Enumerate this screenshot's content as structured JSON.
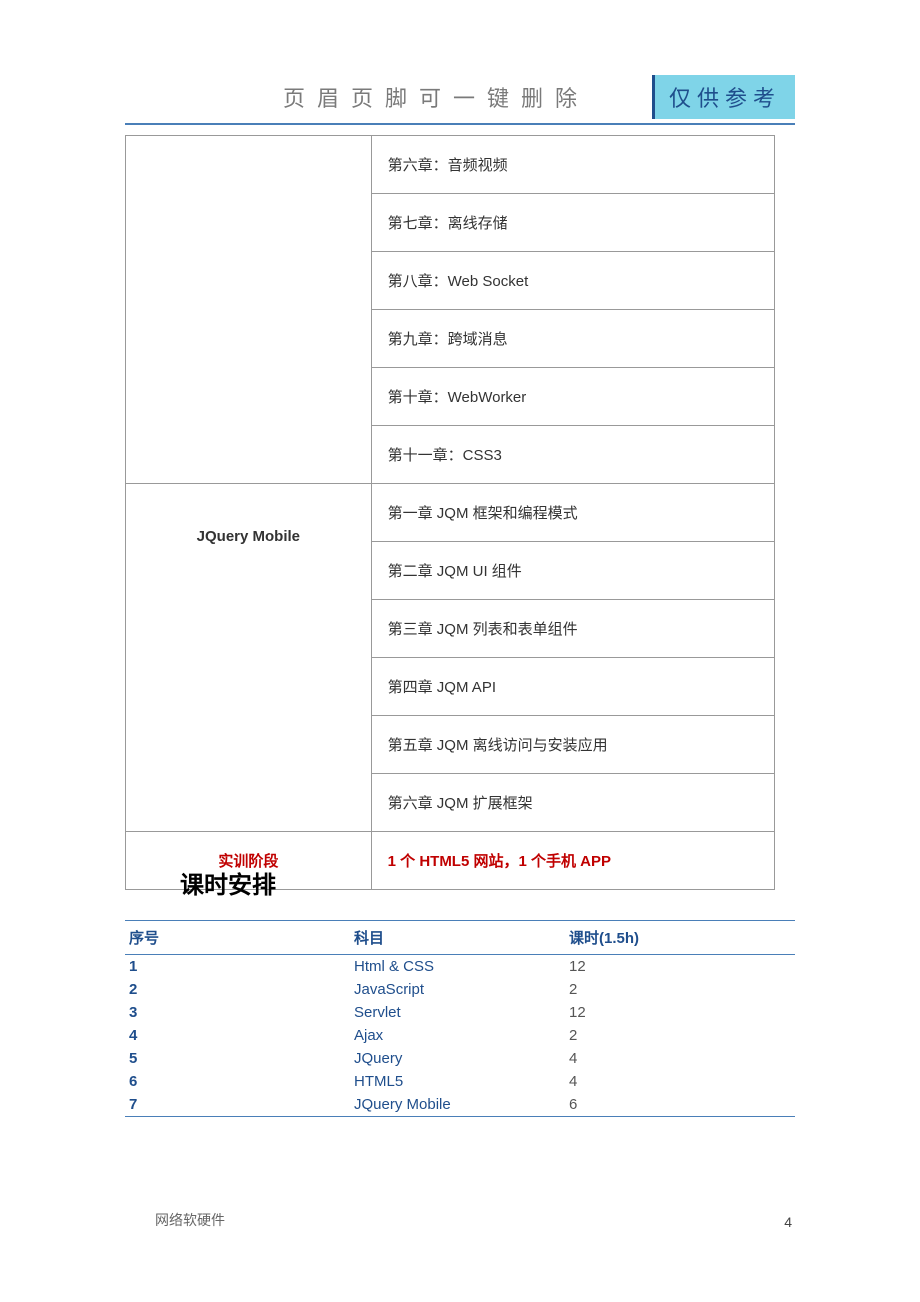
{
  "header": {
    "text": "页眉页脚可一键删除",
    "badge": "仅供参考"
  },
  "chapters": {
    "group1": [
      "第六章：音频视频",
      "第七章：离线存储",
      "第八章：Web Socket",
      "第九章：跨域消息",
      "第十章：WebWorker",
      "第十一章：CSS3"
    ],
    "group2_label": "JQuery Mobile",
    "group2": [
      "第一章 JQM 框架和编程模式",
      "第二章  JQM UI 组件",
      "第三章  JQM  列表和表单组件",
      "第四章  JQM API",
      "第五章  JQM 离线访问与安装应用",
      "第六章  JQM 扩展框架"
    ],
    "training_label": "实训阶段",
    "training_content": "1 个 HTML5 网站，1 个手机 APP"
  },
  "section_heading": "课时安排",
  "schedule": {
    "headers": {
      "num": "序号",
      "subject": "科目",
      "hours": "课时(1.5h)"
    },
    "rows": [
      {
        "num": "1",
        "subject": "Html & CSS",
        "hours": "12"
      },
      {
        "num": "2",
        "subject": "JavaScript",
        "hours": "2"
      },
      {
        "num": "3",
        "subject": "Servlet",
        "hours": "12"
      },
      {
        "num": "4",
        "subject": "Ajax",
        "hours": "2"
      },
      {
        "num": "5",
        "subject": "JQuery",
        "hours": "4"
      },
      {
        "num": "6",
        "subject": "HTML5",
        "hours": "4"
      },
      {
        "num": "7",
        "subject": "JQuery Mobile",
        "hours": "6"
      }
    ]
  },
  "footer": {
    "text": "网络软硬件",
    "page_number": "4"
  }
}
